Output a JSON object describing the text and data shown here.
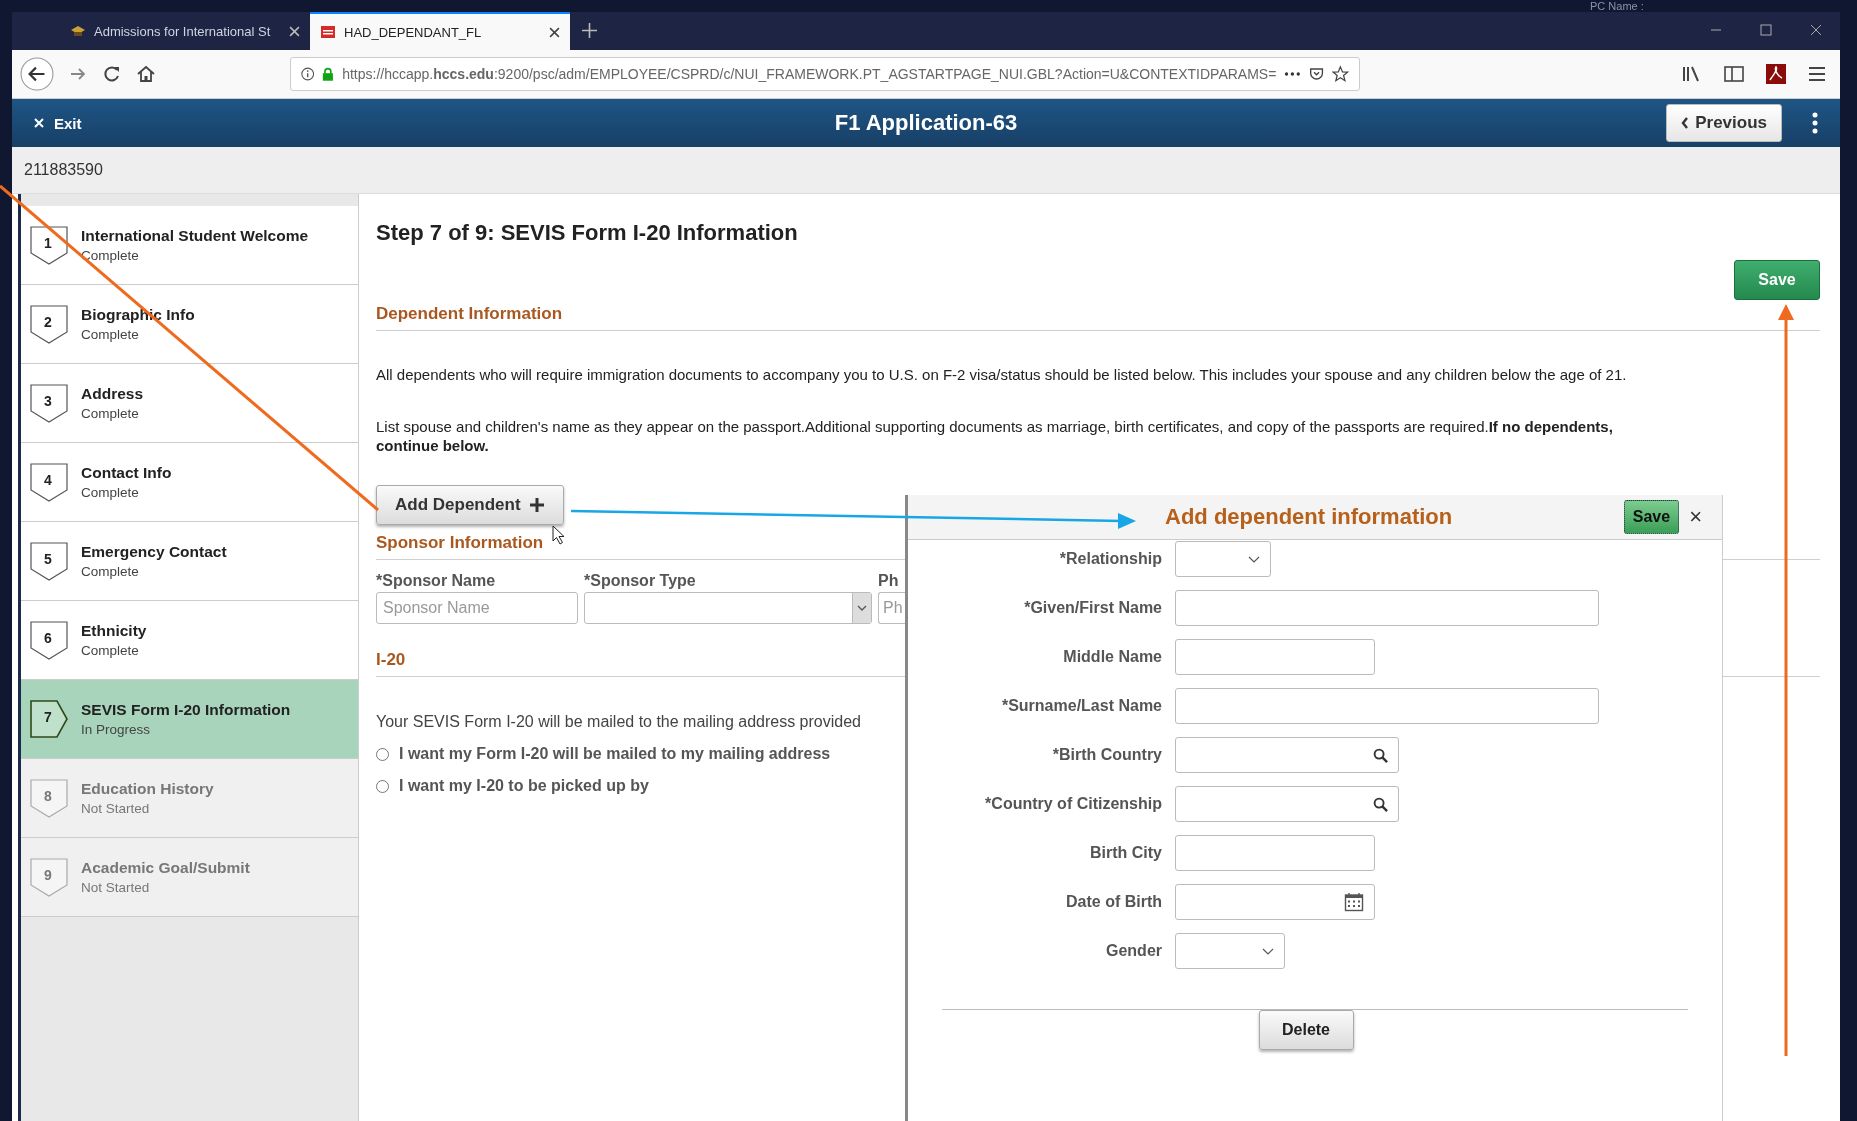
{
  "desktop_text": "PC Name :",
  "browser": {
    "tabs": [
      {
        "title": "Admissions for International St",
        "selected": false
      },
      {
        "title": "HAD_DEPENDANT_FL",
        "selected": true
      }
    ],
    "url": "https://hccapp.**hccs.edu**:9200/psc/adm/EMPLOYEE/CSPRD/c/NUI_FRAMEWORK.PT_AGSTARTPAGE_NUI.GBL?Action=U&CONTEXTIDPARAMS="
  },
  "header": {
    "exit": "Exit",
    "title": "F1 Application-63",
    "previous": "Previous"
  },
  "student_id": "211883590",
  "steps": [
    {
      "number": "1",
      "title": "International Student Welcome",
      "status": "Complete",
      "kind": "complete",
      "selected": false
    },
    {
      "number": "2",
      "title": "Biographic Info",
      "status": "Complete",
      "kind": "complete",
      "selected": false
    },
    {
      "number": "3",
      "title": "Address",
      "status": "Complete",
      "kind": "complete",
      "selected": false
    },
    {
      "number": "4",
      "title": "Contact Info",
      "status": "Complete",
      "kind": "complete",
      "selected": false
    },
    {
      "number": "5",
      "title": "Emergency Contact",
      "status": "Complete",
      "kind": "complete",
      "selected": false
    },
    {
      "number": "6",
      "title": "Ethnicity",
      "status": "Complete",
      "kind": "complete",
      "selected": false
    },
    {
      "number": "7",
      "title": "SEVIS Form I-20 Information",
      "status": "In Progress",
      "kind": "current",
      "selected": true
    },
    {
      "number": "8",
      "title": "Education History",
      "status": "Not Started",
      "kind": "pending",
      "selected": false
    },
    {
      "number": "9",
      "title": "Academic Goal/Submit",
      "status": "Not Started",
      "kind": "pending",
      "selected": false
    }
  ],
  "page": {
    "heading": "Step 7 of 9: SEVIS Form I-20 Information",
    "save": "Save",
    "dependent_section": {
      "title": "Dependent Information",
      "paragraphs": [
        "All dependents who will require immigration documents to accompany you to U.S. on F-2 visa/status should be listed below. This includes your spouse and any children below the age of 21.",
        "List spouse and children's name as they appear on the passport.Additional supporting documents as marriage, birth certificates, and copy of the passports are required.**If no dependents, continue below.**"
      ],
      "add_button": "Add Dependent"
    },
    "sponsor_section": {
      "title": "Sponsor Information",
      "fields": [
        {
          "label": "*Sponsor Name",
          "kind": "text",
          "placeholder": "Sponsor Name"
        },
        {
          "label": "*Sponsor Type",
          "kind": "select"
        },
        {
          "label": "Ph",
          "kind": "cut",
          "placeholder": "Ph"
        }
      ]
    },
    "i20_section": {
      "title": "I-20",
      "text": "Your SEVIS Form I-20 will be mailed to the mailing address provided",
      "options": [
        {
          "label": "I want my Form I-20 will be mailed to my mailing address",
          "selected": false
        },
        {
          "label": "I want my I-20 to be picked up by",
          "selected": false
        }
      ]
    }
  },
  "dialog": {
    "title": "Add dependent information",
    "save": "Save",
    "close": "×",
    "fields": [
      {
        "label": "*Relationship",
        "kind": "select"
      },
      {
        "label": "*Given/First Name",
        "kind": "longtext"
      },
      {
        "label": "Middle Name",
        "kind": "text"
      },
      {
        "label": "*Surname/Last Name",
        "kind": "longtext"
      },
      {
        "label": "*Birth Country",
        "kind": "lookup"
      },
      {
        "label": "*Country of Citizenship",
        "kind": "lookup"
      },
      {
        "label": "Birth City",
        "kind": "text"
      },
      {
        "label": "Date of Birth",
        "kind": "date"
      },
      {
        "label": "Gender",
        "kind": "shortselect"
      }
    ],
    "delete": "Delete"
  }
}
